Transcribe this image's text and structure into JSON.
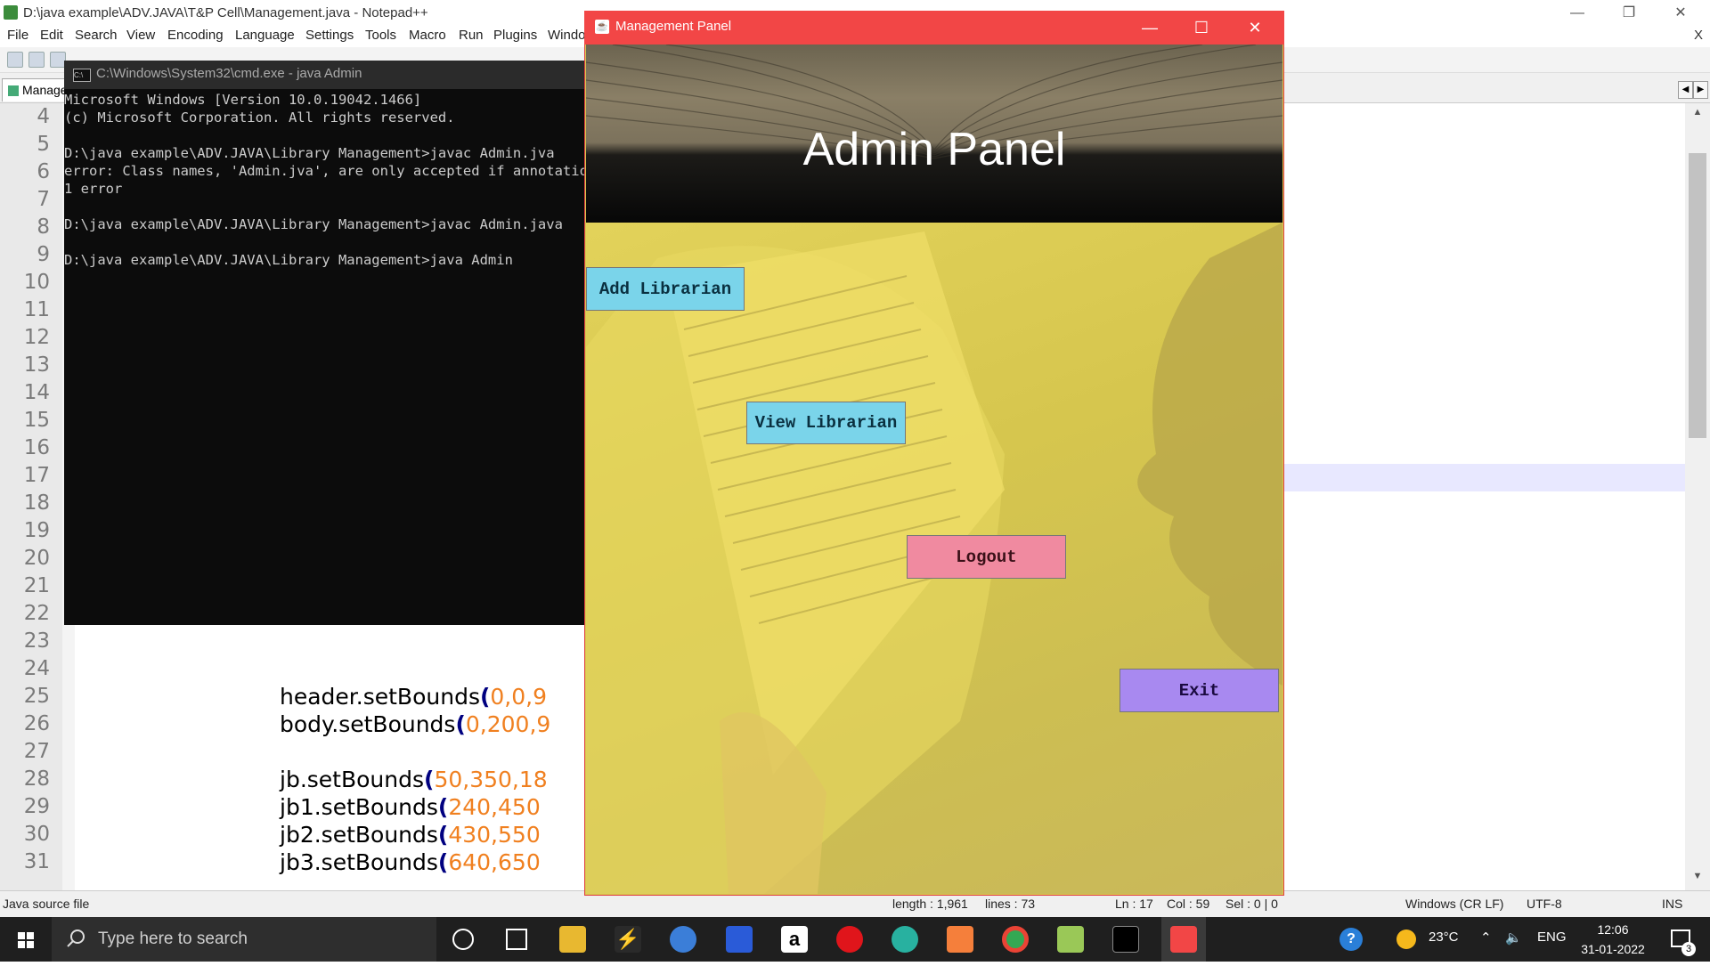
{
  "npp": {
    "title": "D:\\java example\\ADV.JAVA\\T&P Cell\\Management.java - Notepad++",
    "menu": [
      "File",
      "Edit",
      "Search",
      "View",
      "Encoding",
      "Language",
      "Settings",
      "Tools",
      "Macro",
      "Run",
      "Plugins",
      "Windo"
    ],
    "menu_close": "X",
    "tab_label": "Manage",
    "line_numbers": [
      "4",
      "5",
      "6",
      "7",
      "8",
      "9",
      "10",
      "11",
      "12",
      "13",
      "14",
      "15",
      "16",
      "17",
      "18",
      "19",
      "20",
      "21",
      "22",
      "23",
      "24",
      "25",
      "26",
      "27",
      "28",
      "29",
      "30",
      "31"
    ],
    "code_lines": [
      {
        "pre": "header.setBounds",
        "p": "(",
        "args": "0,0,9"
      },
      {
        "pre": "body.setBounds",
        "p": "(",
        "args": "0,200,9"
      },
      {
        "pre": "",
        "p": "",
        "args": ""
      },
      {
        "pre": "jb.setBounds",
        "p": "(",
        "args": "50,350,18"
      },
      {
        "pre": "jb1.setBounds",
        "p": "(",
        "args": "240,450"
      },
      {
        "pre": "jb2.setBounds",
        "p": "(",
        "args": "430,550"
      },
      {
        "pre": "jb3.setBounds",
        "p": "(",
        "args": "640,650"
      }
    ],
    "status": {
      "file_type": "Java source file",
      "length": "length : 1,961",
      "lines": "lines : 73",
      "ln": "Ln : 17",
      "col": "Col : 59",
      "sel": "Sel : 0 | 0",
      "eol": "Windows (CR LF)",
      "encoding": "UTF-8",
      "mode": "INS"
    }
  },
  "cmd": {
    "title": "C:\\Windows\\System32\\cmd.exe - java  Admin",
    "icon_text": "C:\\",
    "lines": [
      "Microsoft Windows [Version 10.0.19042.1466]",
      "(c) Microsoft Corporation. All rights reserved.",
      "",
      "D:\\java example\\ADV.JAVA\\Library Management>javac Admin.jva",
      "error: Class names, 'Admin.jva', are only accepted if annotation",
      "1 error",
      "",
      "D:\\java example\\ADV.JAVA\\Library Management>javac Admin.java",
      "",
      "D:\\java example\\ADV.JAVA\\Library Management>java Admin"
    ]
  },
  "panel": {
    "title": "Management Panel",
    "heading": "Admin Panel",
    "buttons": {
      "add": "Add Librarian",
      "view": "View Librarian",
      "logout": "Logout",
      "exit": "Exit"
    },
    "colors": {
      "titlebar": "#f24646",
      "add": "#7ad4ea",
      "view": "#7ad4ea",
      "logout": "#f08aa0",
      "exit": "#a889f0"
    }
  },
  "taskbar": {
    "search_placeholder": "Type here to search",
    "weather": "23°C",
    "lang": "ENG",
    "time": "12:06",
    "date": "31-01-2022",
    "notif_count": "3"
  }
}
